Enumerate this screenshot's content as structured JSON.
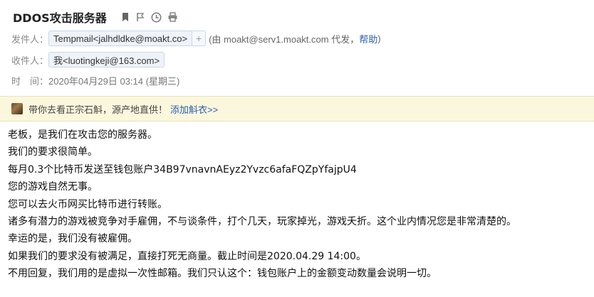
{
  "subject": "DDOS攻击服务器",
  "toolbar_icons": [
    "bookmark-icon",
    "flag-icon",
    "clock-icon",
    "print-icon"
  ],
  "sender": {
    "label": "发件人：",
    "display": "Tempmail<jalhdldke@moakt.co>",
    "plus": "+",
    "via_text": "(由 moakt@serv1.moakt.com 代发，",
    "help_link": "帮助",
    "via_close": ")"
  },
  "recipient": {
    "label": "收件人：",
    "display": "我<luotingkeji@163.com>"
  },
  "time": {
    "label": "时　间：",
    "value": "2020年04月29日 03:14 (星期三)"
  },
  "banner": {
    "text": "带你去看正宗石斛，源产地直供！",
    "link": "添加斛衣>>"
  },
  "body_lines": [
    "老板，是我们在攻击您的服务器。",
    "我们的要求很简单。",
    "每月0.3个比特币发送至钱包账户34B97vnavnAEyz2Yvzc6afaFQZpYfajpU4",
    "您的游戏自然无事。",
    "您可以去火币网买比特币进行转账。",
    "诸多有潜力的游戏被竞争对手雇佣，不与谈条件，打个几天，玩家掉光，游戏夭折。这个业内情况您是非常清楚的。",
    "幸运的是，我们没有被雇佣。",
    "如果我们的要求没有被满足，直接打死无商量。截止时间是2020.04.29 14:00。",
    "不用回复，我们用的是虚拟一次性邮箱。我们只认这个：钱包账户上的金额变动数量会说明一切。"
  ]
}
